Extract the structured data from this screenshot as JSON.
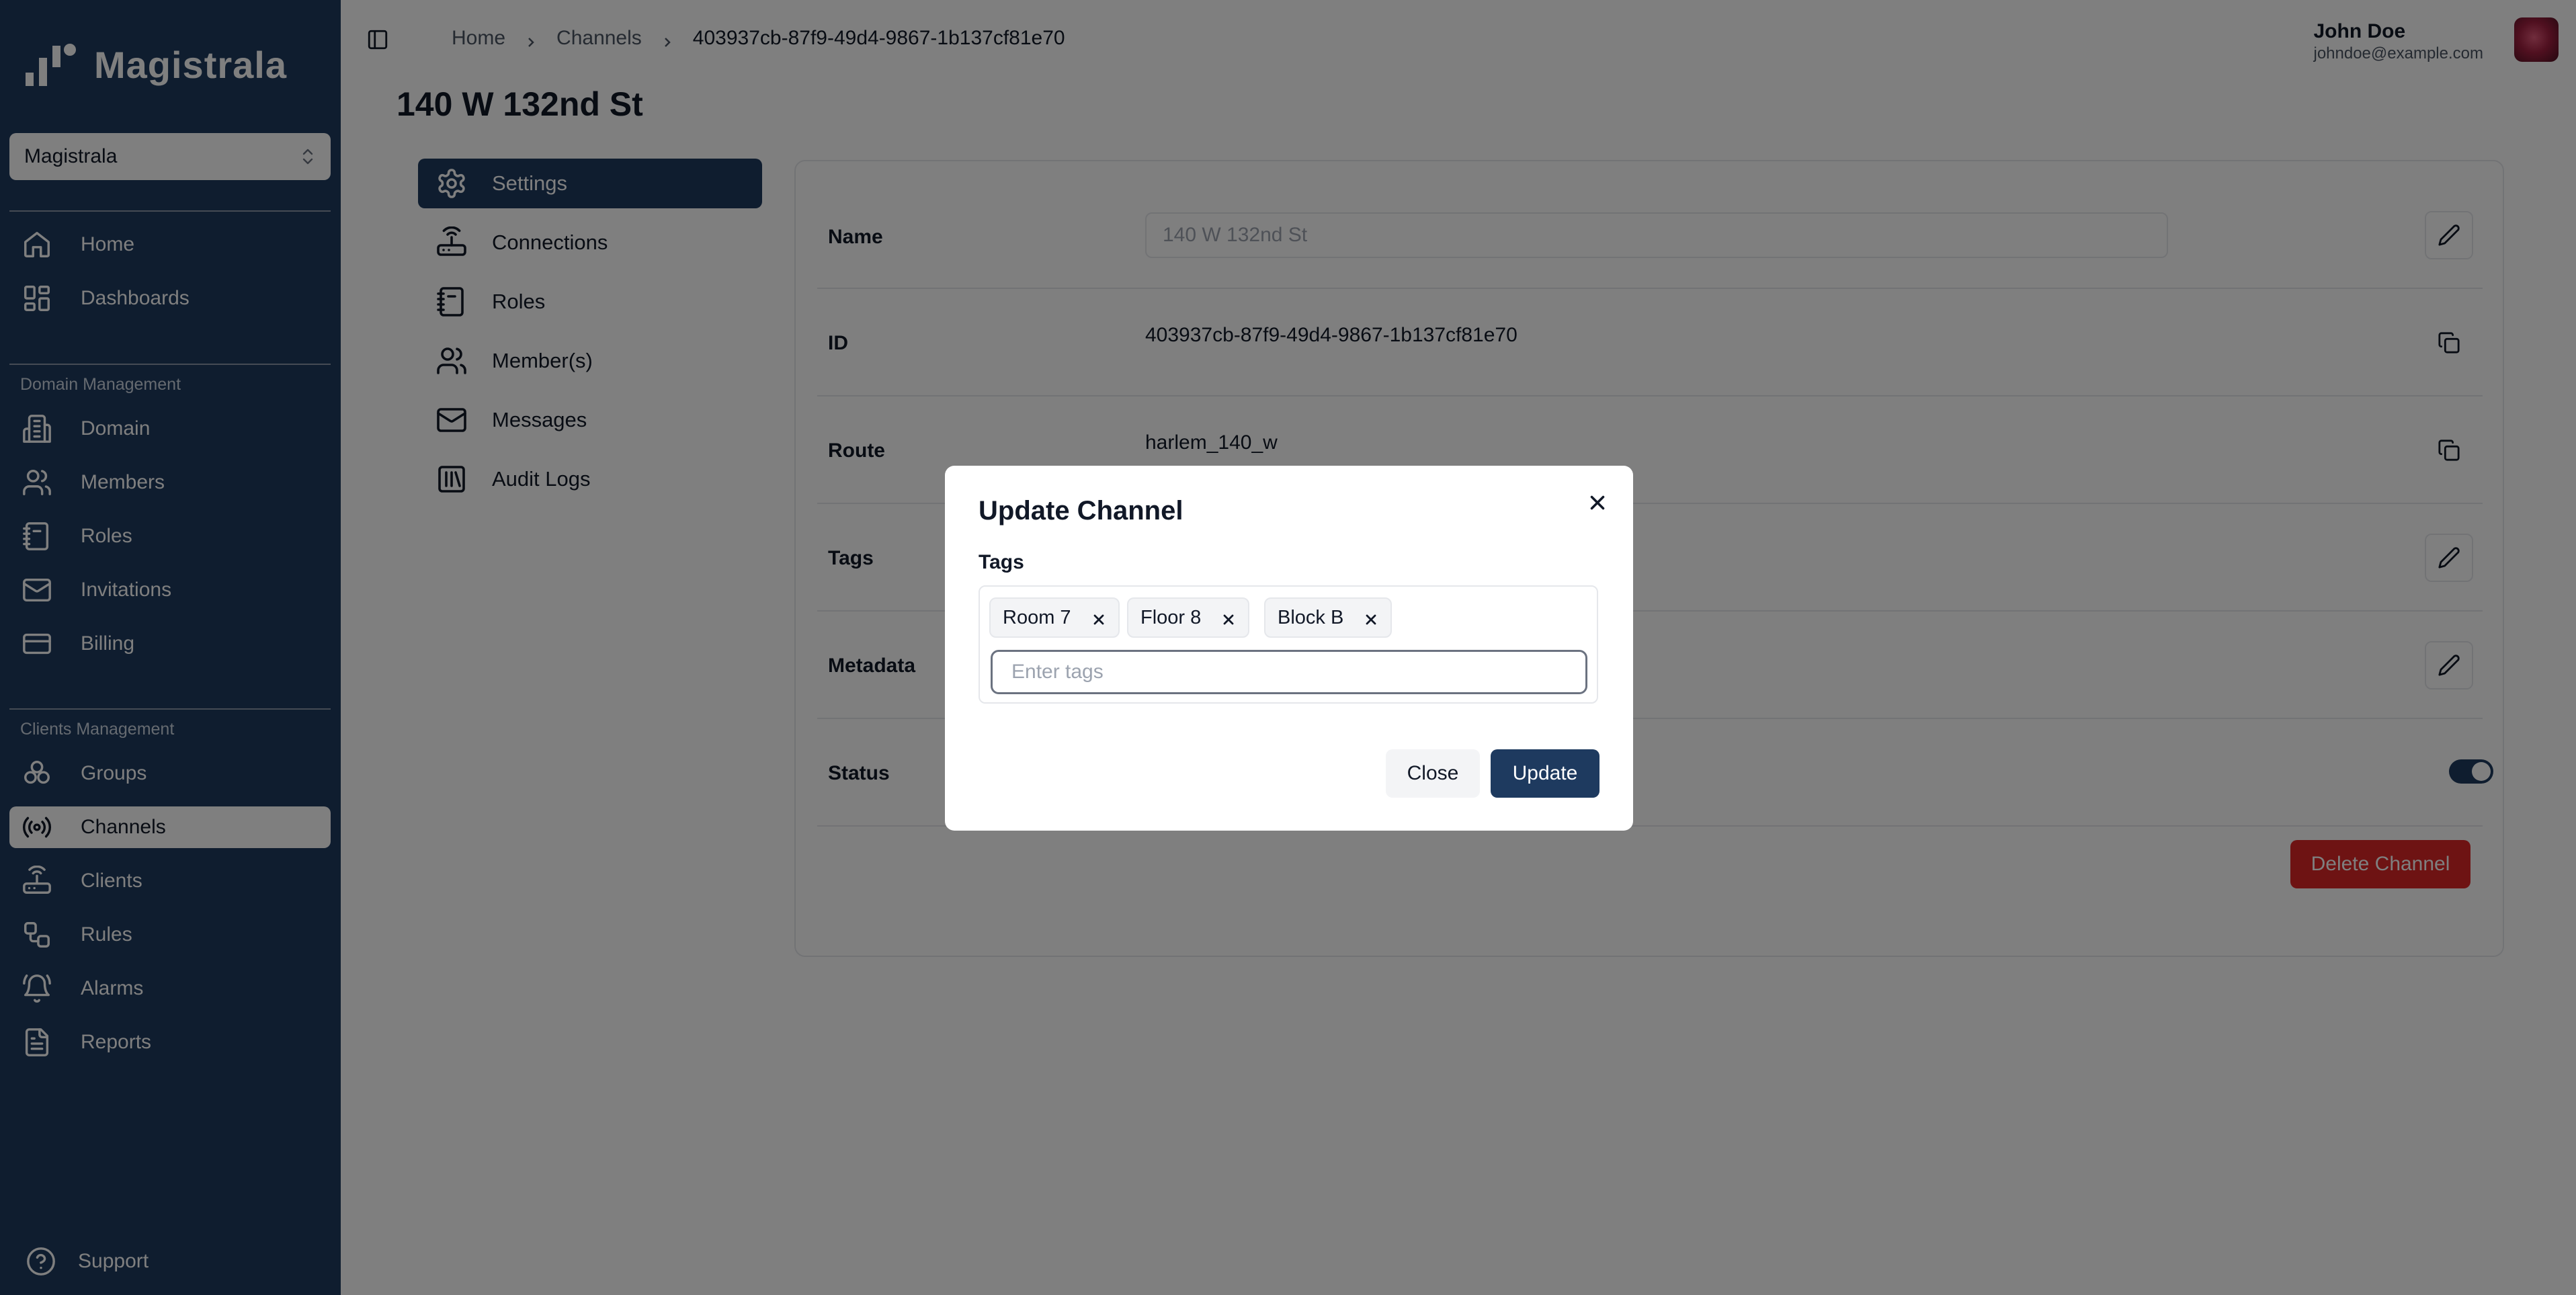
{
  "app": {
    "name": "Magistrala"
  },
  "sidebar": {
    "domain_select": "Magistrala",
    "top_items": [
      {
        "label": "Home",
        "icon": "home-icon"
      },
      {
        "label": "Dashboards",
        "icon": "dashboard-icon"
      }
    ],
    "domain_section_title": "Domain Management",
    "domain_items": [
      {
        "label": "Domain",
        "icon": "building-icon"
      },
      {
        "label": "Members",
        "icon": "users-icon"
      },
      {
        "label": "Roles",
        "icon": "notebook-icon"
      },
      {
        "label": "Invitations",
        "icon": "mail-icon"
      },
      {
        "label": "Billing",
        "icon": "credit-card-icon"
      }
    ],
    "clients_section_title": "Clients Management",
    "clients_items": [
      {
        "label": "Groups",
        "icon": "groups-icon"
      },
      {
        "label": "Channels",
        "icon": "radio-icon",
        "active": true
      },
      {
        "label": "Clients",
        "icon": "router-icon"
      },
      {
        "label": "Rules",
        "icon": "workflow-icon"
      },
      {
        "label": "Alarms",
        "icon": "bell-icon"
      },
      {
        "label": "Reports",
        "icon": "file-text-icon"
      }
    ],
    "support_label": "Support"
  },
  "breadcrumb": {
    "items": [
      "Home",
      "Channels"
    ],
    "current": "403937cb-87f9-49d4-9867-1b137cf81e70"
  },
  "user": {
    "name": "John Doe",
    "email": "johndoe@example.com"
  },
  "page": {
    "title": "140 W 132nd St"
  },
  "settings_nav": [
    {
      "label": "Settings",
      "icon": "gear-icon",
      "active": true
    },
    {
      "label": "Connections",
      "icon": "router-icon"
    },
    {
      "label": "Roles",
      "icon": "notebook-icon"
    },
    {
      "label": "Member(s)",
      "icon": "users-icon"
    },
    {
      "label": "Messages",
      "icon": "mail-icon"
    },
    {
      "label": "Audit Logs",
      "icon": "library-icon"
    }
  ],
  "details": {
    "name_label": "Name",
    "name_value": "140 W 132nd St",
    "id_label": "ID",
    "id_value": "403937cb-87f9-49d4-9867-1b137cf81e70",
    "route_label": "Route",
    "route_value": "harlem_140_w",
    "tags_label": "Tags",
    "metadata_label": "Metadata",
    "status_label": "Status",
    "status_enabled": true,
    "delete_label": "Delete Channel"
  },
  "modal": {
    "title": "Update Channel",
    "tags_label": "Tags",
    "tags": [
      "Room 7",
      "Floor 8",
      "Block B"
    ],
    "input_placeholder": "Enter tags",
    "close_label": "Close",
    "update_label": "Update"
  },
  "colors": {
    "sidebar_bg": "#1e3a5f",
    "primary": "#1e3a5f",
    "danger": "#dc2626",
    "overlay": "rgba(0,0,0,0.5)"
  }
}
